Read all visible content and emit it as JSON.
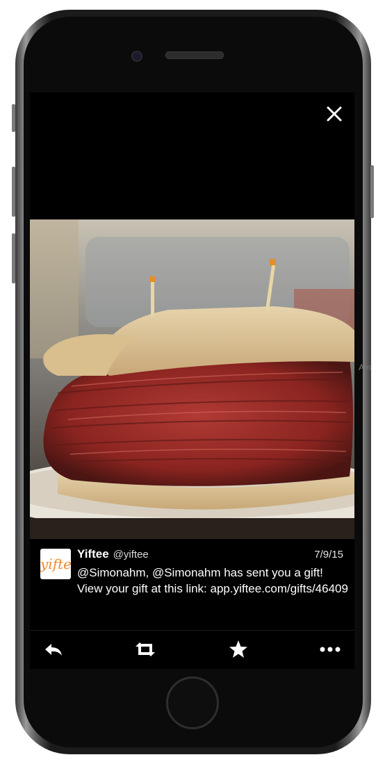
{
  "viewer": {
    "close_icon": "close-icon"
  },
  "photo": {
    "description_icon": "sandwich-photo"
  },
  "edge_hint": "Am",
  "tweet": {
    "display_name": "Yiftee",
    "handle": "@yiftee",
    "date": "7/9/15",
    "text": "@Simonahm, @Simonahm has sent you a gift! View your gift at this link: app.yiftee.com/gifts/46409",
    "avatar_text": "yiftee",
    "avatar_color": "#f08a2b"
  },
  "actions": [
    {
      "name": "reply",
      "icon": "reply-icon"
    },
    {
      "name": "retweet",
      "icon": "retweet-icon"
    },
    {
      "name": "favorite",
      "icon": "star-icon"
    },
    {
      "name": "more",
      "icon": "more-icon"
    }
  ],
  "colors": {
    "screen_bg": "#000000",
    "text": "#ffffff",
    "phone_body": "#1b1b1b"
  }
}
